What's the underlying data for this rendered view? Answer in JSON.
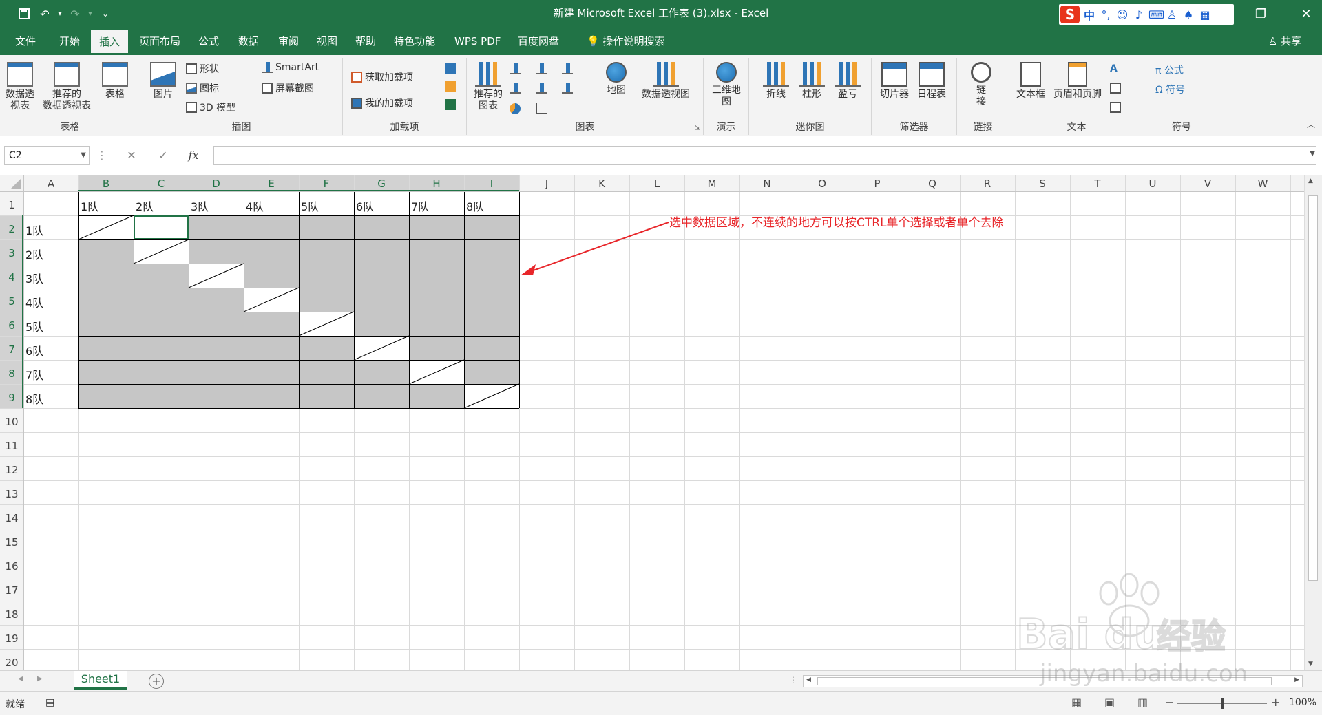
{
  "window": {
    "title": "新建 Microsoft Excel 工作表 (3).xlsx  -  Excel",
    "ime": {
      "logo": "S",
      "mode": "中",
      "punct": "°,"
    }
  },
  "tabs": [
    "文件",
    "开始",
    "插入",
    "页面布局",
    "公式",
    "数据",
    "审阅",
    "视图",
    "帮助",
    "特色功能",
    "WPS PDF",
    "百度网盘",
    "操作说明搜索"
  ],
  "share_label": "共享",
  "ribbon": {
    "groups": {
      "tables": "表格",
      "illustrations": "插图",
      "addins": "加载项",
      "charts": "图表",
      "tours": "演示",
      "sparklines": "迷你图",
      "filters": "筛选器",
      "links": "链接",
      "text": "文本",
      "symbols": "符号"
    },
    "buttons": {
      "pivot_table": "数据透\n视表",
      "recommended_pivot": "推荐的\n数据透视表",
      "table": "表格",
      "pictures": "图片",
      "shapes": "形状",
      "icons": "图标",
      "models_3d": "3D 模型",
      "smartart": "SmartArt",
      "screenshot": "屏幕截图",
      "get_addins": "获取加载项",
      "my_addins": "我的加载项",
      "recommended_charts": "推荐的\n图表",
      "maps": "地图",
      "pivot_chart": "数据透视图",
      "map_3d": "三维地\n图",
      "line": "折线",
      "column": "柱形",
      "win_loss": "盈亏",
      "slicer": "切片器",
      "timeline": "日程表",
      "link": "链\n接",
      "textbox": "文本框",
      "header_footer": "页眉和页脚",
      "equation": "π 公式",
      "symbol": "Ω 符号"
    }
  },
  "formula_bar": {
    "name_box": "C2",
    "cancel": "✕",
    "enter": "✓",
    "fx": "fx",
    "value": ""
  },
  "sheet": {
    "columns": [
      "A",
      "B",
      "C",
      "D",
      "E",
      "F",
      "G",
      "H",
      "I",
      "J",
      "K",
      "L",
      "M",
      "N",
      "O",
      "P",
      "Q",
      "R",
      "S",
      "T",
      "U",
      "V",
      "W"
    ],
    "rows": [
      "1",
      "2",
      "3",
      "4",
      "5",
      "6",
      "7",
      "8",
      "9",
      "10",
      "11",
      "12",
      "13",
      "14",
      "15",
      "16",
      "17",
      "18",
      "19",
      "20"
    ],
    "header_row": [
      "1队",
      "2队",
      "3队",
      "4队",
      "5队",
      "6队",
      "7队",
      "8队"
    ],
    "header_col": [
      "1队",
      "2队",
      "3队",
      "4队",
      "5队",
      "6队",
      "7队",
      "8队"
    ],
    "active_cell": "C2",
    "annotation": "选中数据区域，不连续的地方可以按CTRL单个选择或者单个去除",
    "colors": {
      "selected_fill": "#c6c6c6",
      "annotation": "#e8262a",
      "accent": "#217346"
    }
  },
  "sheet_tabs": [
    "Sheet1"
  ],
  "status": {
    "ready": "就绪",
    "zoom": "100%"
  },
  "watermark": {
    "brand": "Bai  du",
    "product": "经验",
    "url": "jingyan.baidu.com"
  }
}
